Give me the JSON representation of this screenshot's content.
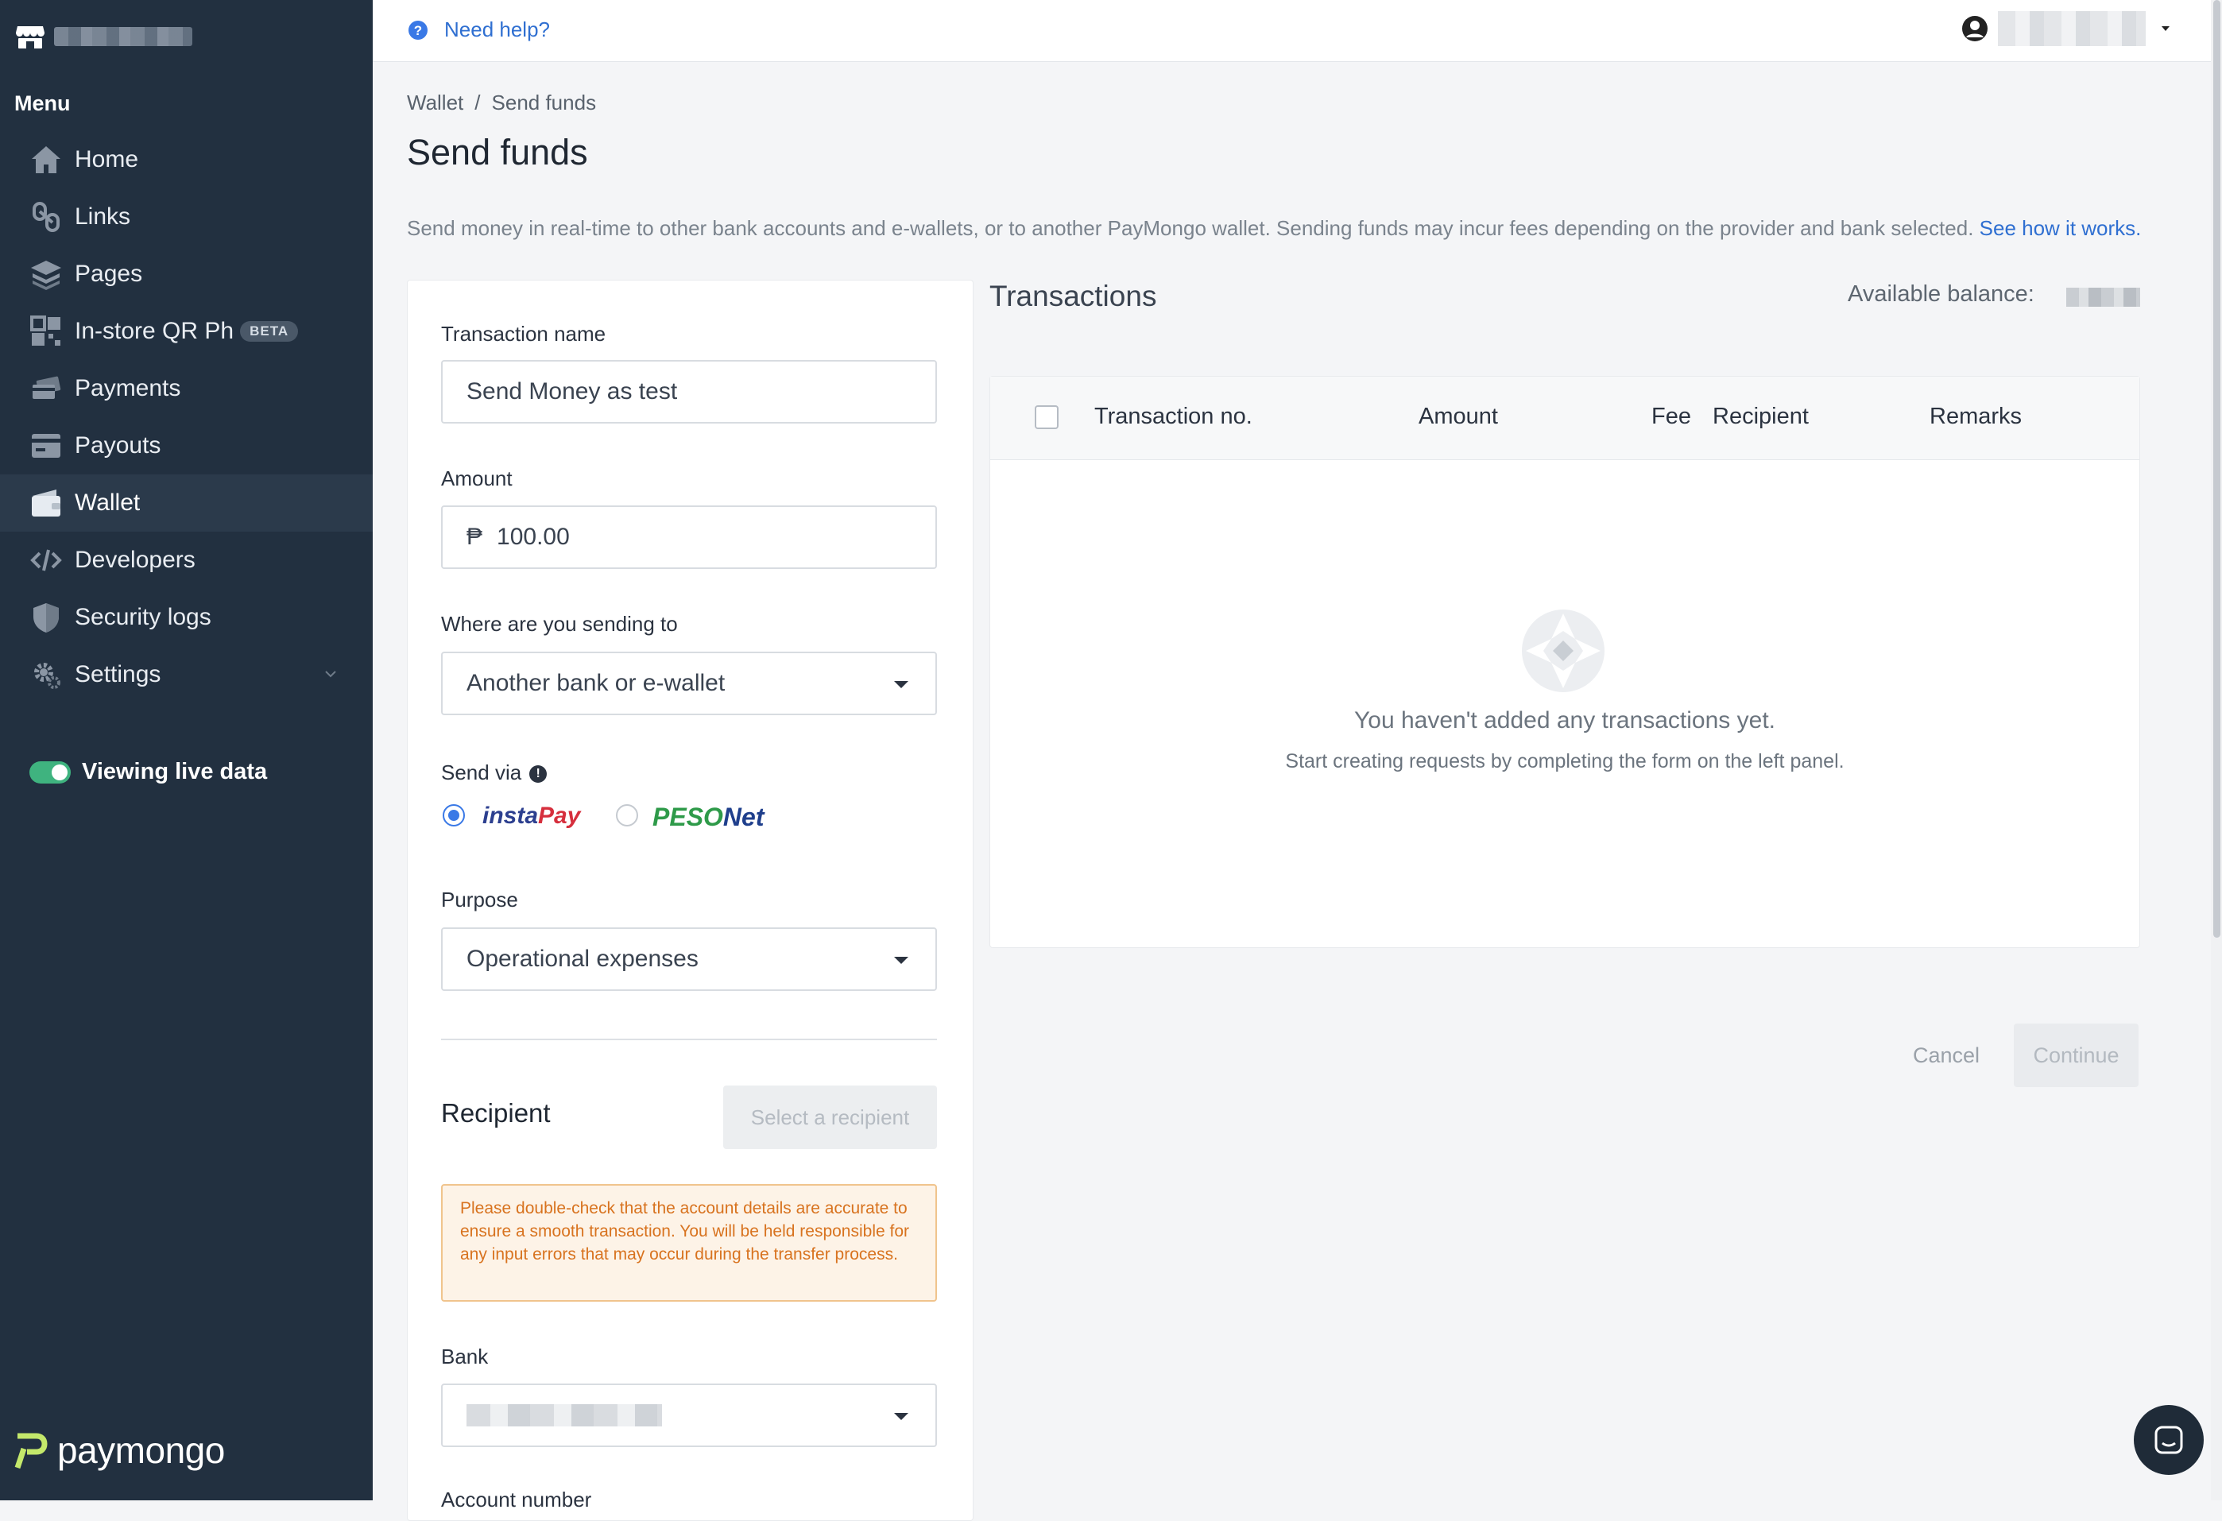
{
  "sidebar": {
    "menu_title": "Menu",
    "items": [
      {
        "label": "Home",
        "icon": "home-icon"
      },
      {
        "label": "Links",
        "icon": "links-icon"
      },
      {
        "label": "Pages",
        "icon": "pages-icon"
      },
      {
        "label": "In-store QR Ph",
        "icon": "qr-icon",
        "badge": "BETA"
      },
      {
        "label": "Payments",
        "icon": "payments-icon"
      },
      {
        "label": "Payouts",
        "icon": "payouts-icon"
      },
      {
        "label": "Wallet",
        "icon": "wallet-icon",
        "active": true
      },
      {
        "label": "Developers",
        "icon": "code-icon"
      },
      {
        "label": "Security logs",
        "icon": "shield-icon"
      },
      {
        "label": "Settings",
        "icon": "gear-icon",
        "expandable": true
      }
    ],
    "live_toggle_label": "Viewing live data",
    "live_toggle_on": true,
    "logo_text": "paymongo"
  },
  "topbar": {
    "help_label": "Need help?"
  },
  "breadcrumb": [
    "Wallet",
    "Send funds"
  ],
  "page": {
    "title": "Send funds",
    "description": "Send money in real-time to other bank accounts and e-wallets, or to another PayMongo wallet. Sending funds may incur fees depending on the provider and bank selected.",
    "description_link": "See how it works."
  },
  "form": {
    "transaction_name_label": "Transaction name",
    "transaction_name_value": "Send Money as test",
    "amount_label": "Amount",
    "currency_symbol": "₱",
    "amount_value": "100.00",
    "destination_label": "Where are you sending to",
    "destination_value": "Another bank or e-wallet",
    "send_via_label": "Send via",
    "send_via_options": [
      {
        "name": "InstaPay",
        "part1": "insta",
        "part2": "Pay",
        "selected": true
      },
      {
        "name": "PESONet",
        "part1": "PESO",
        "part2": "Net",
        "selected": false
      }
    ],
    "purpose_label": "Purpose",
    "purpose_value": "Operational expenses",
    "recipient_title": "Recipient",
    "select_recipient_label": "Select a recipient",
    "warning_text": "Please double-check that the account details are accurate to ensure a smooth transaction. You will be held responsible for any input errors that may occur during the transfer process.",
    "bank_label": "Bank",
    "account_number_label": "Account number"
  },
  "transactions": {
    "title": "Transactions",
    "balance_label": "Available balance:",
    "columns": [
      "Transaction no.",
      "Amount",
      "Fee",
      "Recipient",
      "Remarks"
    ],
    "rows": [],
    "empty_title": "You haven't added any transactions yet.",
    "empty_subtitle": "Start creating requests by completing the form on the left panel."
  },
  "actions": {
    "cancel_label": "Cancel",
    "continue_label": "Continue"
  },
  "colors": {
    "sidebar_bg": "#223040",
    "link": "#2f6fd1",
    "toggle_on": "#3fb37f",
    "warning_text": "#d8731f",
    "radio_selected": "#3a79e6"
  }
}
